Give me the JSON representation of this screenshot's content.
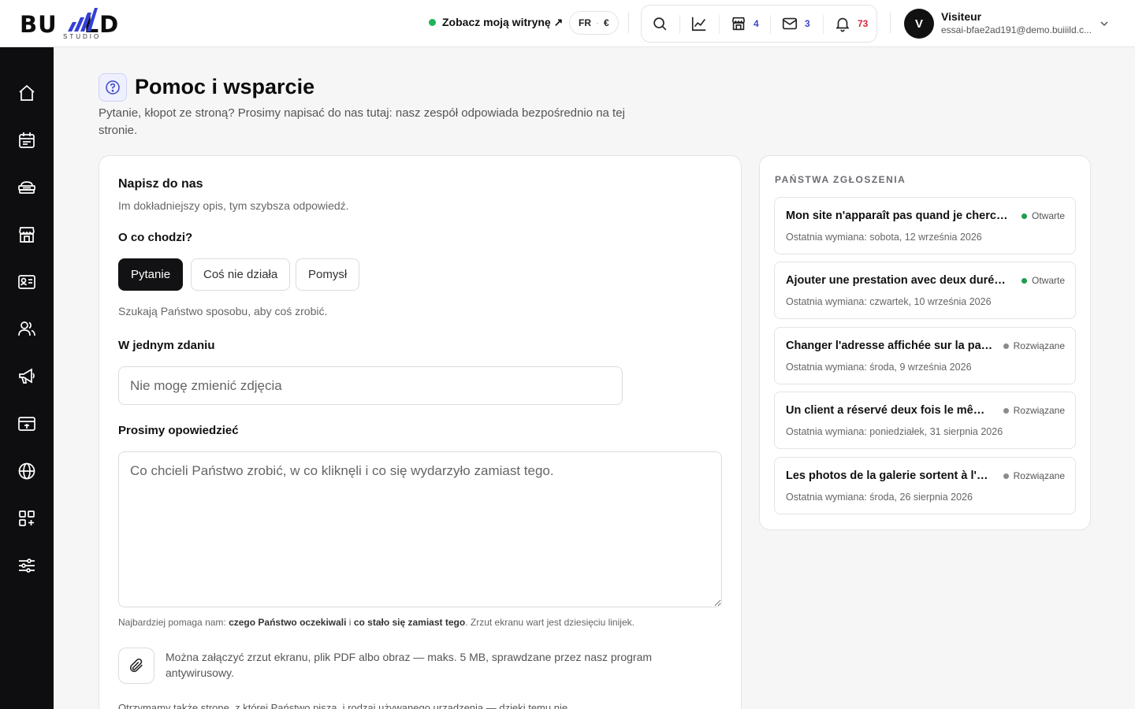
{
  "brand": {
    "logo_text_left": "BU",
    "logo_text_right": "LD",
    "logo_sub": "STUDIO"
  },
  "topbar": {
    "site_link": "Zobacz moją witrynę ↗",
    "status_color": "#1fb45a",
    "lang": "FR",
    "currency": "€",
    "icons": {
      "search": "search-icon",
      "stats": "chart-line-icon",
      "shop": "store-icon",
      "mail": "mail-icon",
      "bell": "bell-icon"
    },
    "shop_count": "4",
    "mail_count": "3",
    "notif_count": "73"
  },
  "user": {
    "initial": "V",
    "name": "Visiteur",
    "email": "essai-bfae2ad191@demo.buiiild.c..."
  },
  "sidebar": {
    "items": [
      "home-icon",
      "calendar-icon",
      "services-icon",
      "store-icon",
      "contact-card-icon",
      "users-icon",
      "megaphone-icon",
      "payment-card-icon",
      "globe-icon",
      "apps-add-icon",
      "settings-sliders-icon"
    ]
  },
  "page": {
    "title": "Pomoc i wsparcie",
    "subtitle": "Pytanie, kłopot ze stroną? Prosimy napisać do nas tutaj: nasz zespół odpowiada bezpośrednio na tej stronie."
  },
  "form": {
    "title": "Napisz do nas",
    "subtitle": "Im dokładniejszy opis, tym szybsza odpowiedź.",
    "topic_label": "O co chodzi?",
    "topics": [
      "Pytanie",
      "Coś nie działa",
      "Pomysł"
    ],
    "selected_topic": "Pytanie",
    "topic_hint": "Szukają Państwo sposobu, aby coś zrobić.",
    "summary_label": "W jednym zdaniu",
    "summary_placeholder": "Nie mogę zmienić zdjęcia",
    "details_label": "Prosimy opowiedzieć",
    "details_placeholder": "Co chcieli Państwo zrobić, w co kliknęli i co się wydarzyło zamiast tego.",
    "tip_prefix": "Najbardziej pomaga nam: ",
    "tip_bold1": "czego Państwo oczekiwali",
    "tip_mid": " i ",
    "tip_bold2": "co stało się zamiast tego",
    "tip_suffix": ". Zrzut ekranu wart jest dziesięciu linijek.",
    "attach_text": "Można załączyć zrzut ekranu, plik PDF albo obraz — maks. 5 MB, sprawdzane przez nasz program antywirusowy.",
    "footer_cut": "Otrzymamy także stronę, z której Państwo piszą, i rodzaj używanego urządzenia — dzięki temu nie"
  },
  "tickets": {
    "heading": "PAŃSTWA ZGŁOSZENIA",
    "items": [
      {
        "title": "Mon site n'apparaît pas quand je cherche sur Google",
        "status": "Otwarte",
        "status_color": "#1e9c4e",
        "date": "Ostatnia wymiana: sobota, 12 września 2026"
      },
      {
        "title": "Ajouter une prestation avec deux durées différentes",
        "status": "Otwarte",
        "status_color": "#1e9c4e",
        "date": "Ostatnia wymiana: czwartek, 10 września 2026"
      },
      {
        "title": "Changer l'adresse affichée sur la page contact",
        "status": "Rozwiązane",
        "status_color": "#8a8a90",
        "date": "Ostatnia wymiana: środa, 9 września 2026"
      },
      {
        "title": "Un client a réservé deux fois le même créneau",
        "status": "Rozwiązane",
        "status_color": "#8a8a90",
        "date": "Ostatnia wymiana: poniedziałek, 31 sierpnia 2026"
      },
      {
        "title": "Les photos de la galerie sortent à l'envers",
        "status": "Rozwiązane",
        "status_color": "#8a8a90",
        "date": "Ostatnia wymiana: środa, 26 sierpnia 2026"
      }
    ]
  }
}
